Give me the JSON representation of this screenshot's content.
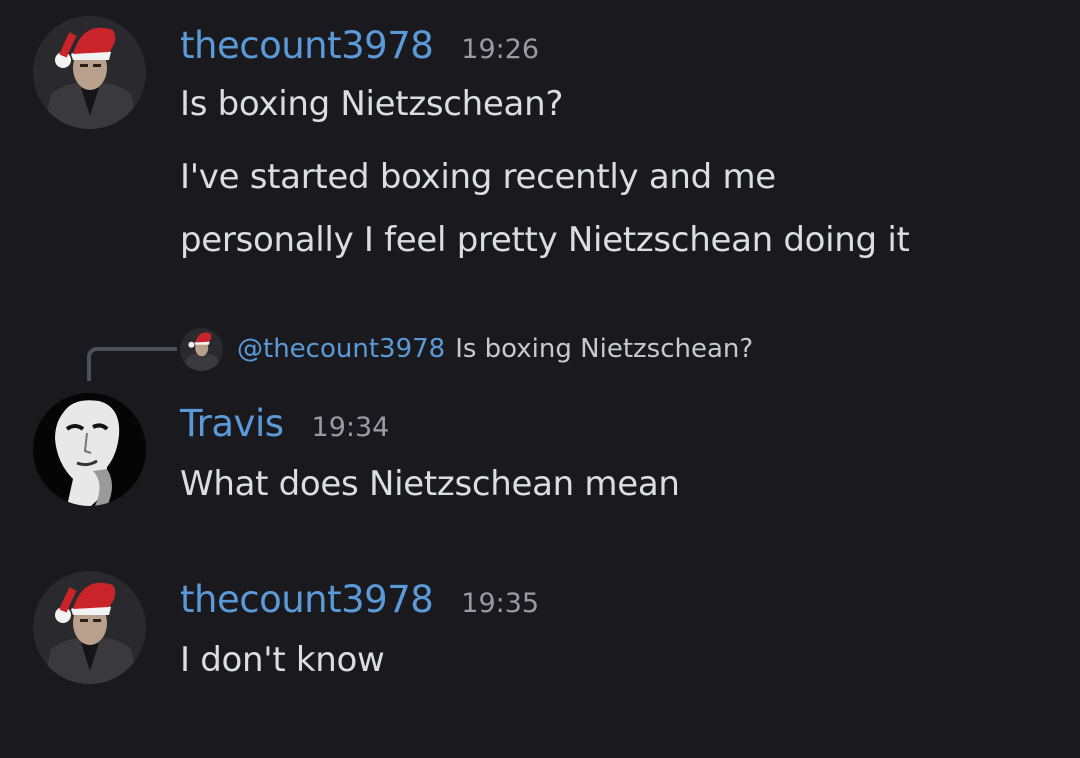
{
  "messages": [
    {
      "author": "thecount3978",
      "time": "19:26",
      "avatar": "santa-hat-man-avatar",
      "lines": [
        "Is boxing Nietzschean?",
        "I've started boxing recently and me",
        "personally I feel pretty Nietzschean doing it"
      ]
    },
    {
      "author": "Travis",
      "time": "19:34",
      "avatar": "bw-face-avatar",
      "reply_to": {
        "mention": "@thecount3978",
        "text": "Is boxing Nietzschean?"
      },
      "lines": [
        "What does Nietzschean mean"
      ]
    },
    {
      "author": "thecount3978",
      "time": "19:35",
      "avatar": "santa-hat-man-avatar",
      "lines": [
        "I don't know"
      ]
    }
  ],
  "colors": {
    "background": "#1a1a1e",
    "username": "#5b9ad8",
    "timestamp": "#9a9ba0",
    "text": "#dcdde0",
    "reply_line": "#4e5058"
  }
}
